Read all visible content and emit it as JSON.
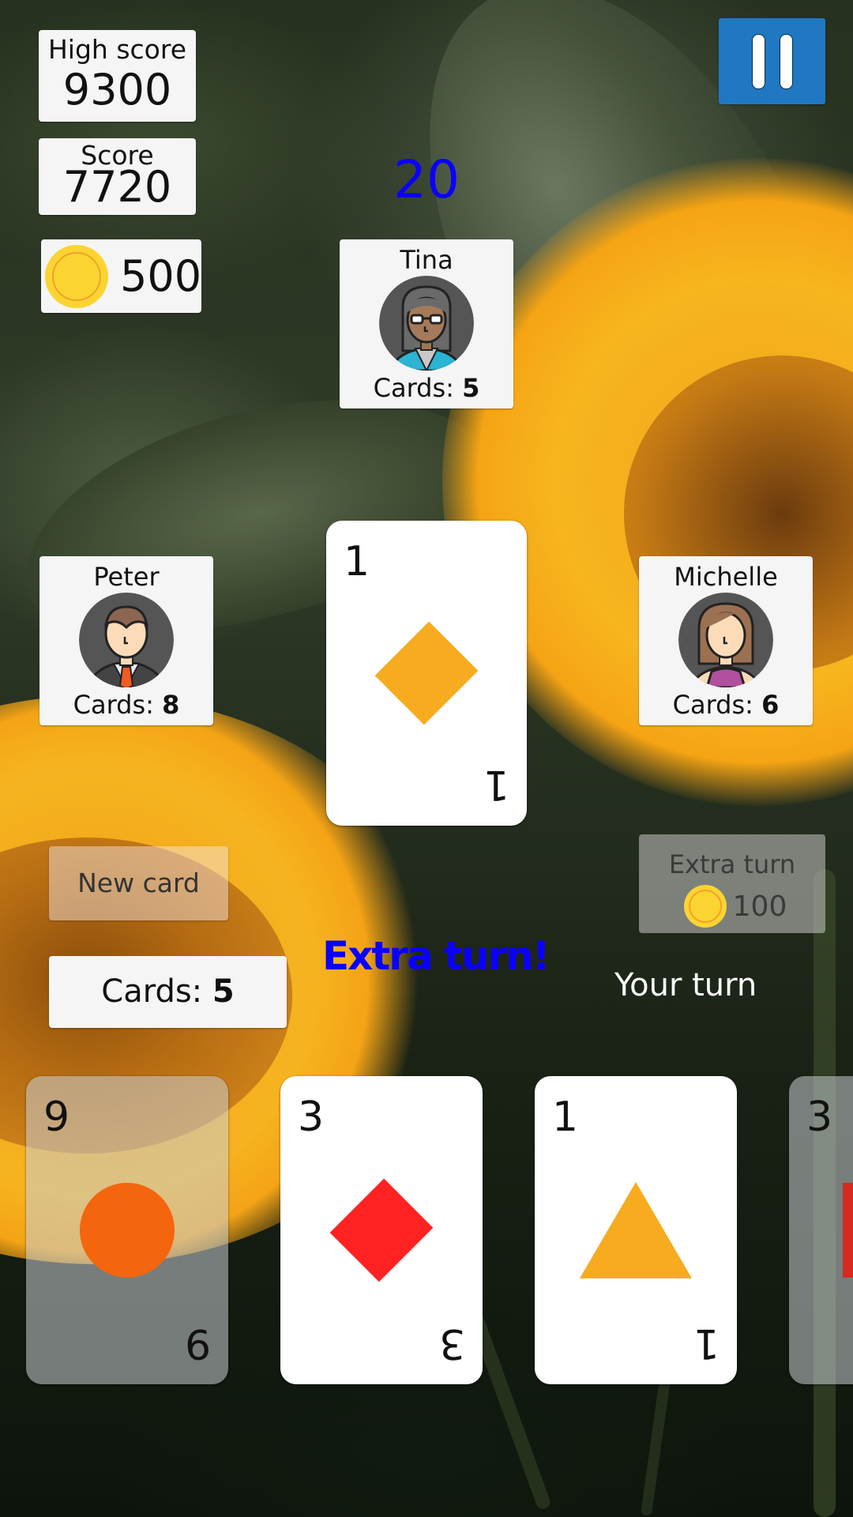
{
  "stats": {
    "high_score_label": "High score",
    "high_score_value": "9300",
    "score_label": "Score",
    "score_value": "7720",
    "coins_value": "500",
    "coin_icon": "coin-icon"
  },
  "pause_button": {
    "icon": "pause-icon"
  },
  "timer": {
    "value": "20",
    "color": "#0a00ff"
  },
  "opponents": [
    {
      "name": "Tina",
      "cards_label": "Cards:",
      "cards_count": "5",
      "avatar": "woman-with-glasses-avatar"
    },
    {
      "name": "Peter",
      "cards_label": "Cards:",
      "cards_count": "8",
      "avatar": "man-in-suit-avatar"
    },
    {
      "name": "Michelle",
      "cards_label": "Cards:",
      "cards_count": "6",
      "avatar": "woman-avatar"
    }
  ],
  "discard_pile": {
    "rank": "1",
    "shape": "diamond",
    "color": "#f7ab1e"
  },
  "actions": {
    "new_card_label": "New card",
    "hand_count_label": "Cards:",
    "hand_count_value": "5",
    "extra_turn_label": "Extra turn",
    "extra_turn_cost": "100"
  },
  "messages": {
    "extra_turn": "Extra turn!",
    "your_turn": "Your turn"
  },
  "hand": [
    {
      "rank": "9",
      "shape": "circle",
      "color": "#f4650e",
      "playable": false
    },
    {
      "rank": "3",
      "shape": "diamond",
      "color": "#ff2222",
      "playable": true
    },
    {
      "rank": "1",
      "shape": "triangle",
      "color": "#f7ab1e",
      "playable": true
    },
    {
      "rank": "3",
      "shape": "square",
      "color": "#d62a1e",
      "playable": false
    }
  ]
}
